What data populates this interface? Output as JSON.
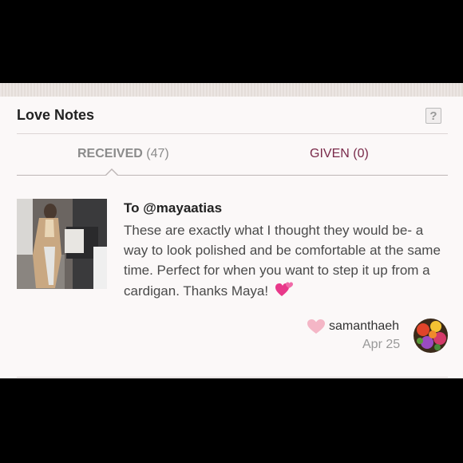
{
  "header": {
    "title": "Love Notes",
    "help_label": "?"
  },
  "tabs": {
    "received_label": "RECEIVED",
    "received_count": "(47)",
    "given_label": "GIVEN (0)"
  },
  "note": {
    "to": "To @mayaatias",
    "text": "These are exactly what I thought they would be- a way to look polished and be comfortable at the same time. Perfect for when you want to step it up from a cardigan. Thanks Maya!",
    "emoji": "💕",
    "author": "samanthaeh",
    "date": "Apr 25"
  },
  "icons": {
    "help": "question-icon",
    "heart": "heart-icon",
    "emoji_hearts": "two-hearts-emoji"
  },
  "colors": {
    "panel_bg": "#fbf8f8",
    "given_tab": "#7a2a4a",
    "heart": "#f4b6c6"
  }
}
